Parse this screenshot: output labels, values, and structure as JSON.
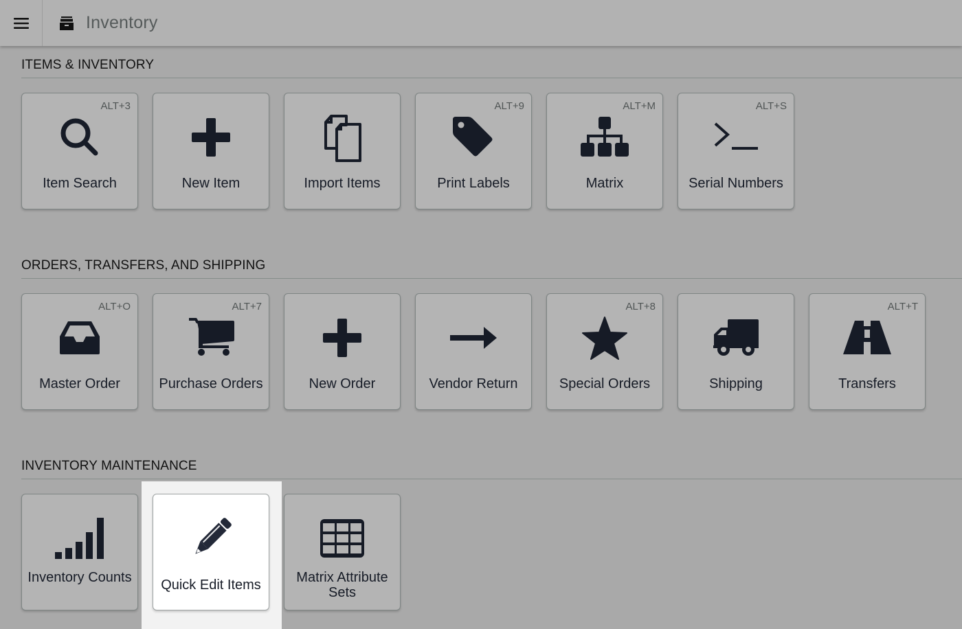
{
  "header": {
    "menu_icon": "hamburger-menu-icon",
    "app_icon": "archive-box-icon",
    "title": "Inventory"
  },
  "sections": [
    {
      "title": "ITEMS & INVENTORY",
      "tiles": [
        {
          "label": "Item Search",
          "shortcut": "ALT+3",
          "icon": "search-icon"
        },
        {
          "label": "New Item",
          "shortcut": "",
          "icon": "plus-icon"
        },
        {
          "label": "Import Items",
          "shortcut": "",
          "icon": "copy-files-icon"
        },
        {
          "label": "Print Labels",
          "shortcut": "ALT+9",
          "icon": "tag-icon"
        },
        {
          "label": "Matrix",
          "shortcut": "ALT+M",
          "icon": "sitemap-icon"
        },
        {
          "label": "Serial Numbers",
          "shortcut": "ALT+S",
          "icon": "terminal-icon"
        }
      ]
    },
    {
      "title": "ORDERS, TRANSFERS, AND SHIPPING",
      "tiles": [
        {
          "label": "Master Order",
          "shortcut": "ALT+O",
          "icon": "inbox-icon"
        },
        {
          "label": "Purchase Orders",
          "shortcut": "ALT+7",
          "icon": "shopping-cart-icon"
        },
        {
          "label": "New Order",
          "shortcut": "",
          "icon": "plus-icon"
        },
        {
          "label": "Vendor Return",
          "shortcut": "",
          "icon": "arrow-right-icon"
        },
        {
          "label": "Special Orders",
          "shortcut": "ALT+8",
          "icon": "star-icon"
        },
        {
          "label": "Shipping",
          "shortcut": "",
          "icon": "truck-icon"
        },
        {
          "label": "Transfers",
          "shortcut": "ALT+T",
          "icon": "road-icon"
        }
      ]
    },
    {
      "title": "INVENTORY MAINTENANCE",
      "tiles": [
        {
          "label": "Inventory Counts",
          "shortcut": "",
          "icon": "signal-bars-icon"
        },
        {
          "label": "Quick Edit Items",
          "shortcut": "",
          "icon": "pencil-icon",
          "selected": true
        },
        {
          "label": "Matrix Attribute Sets",
          "shortcut": "",
          "icon": "table-grid-icon"
        }
      ]
    }
  ],
  "colors": {
    "overlay_background": "#a9a9a9",
    "tile_background": "#b4b4b4",
    "selected_tile_background": "#ffffff",
    "icon_color": "#161b26"
  }
}
